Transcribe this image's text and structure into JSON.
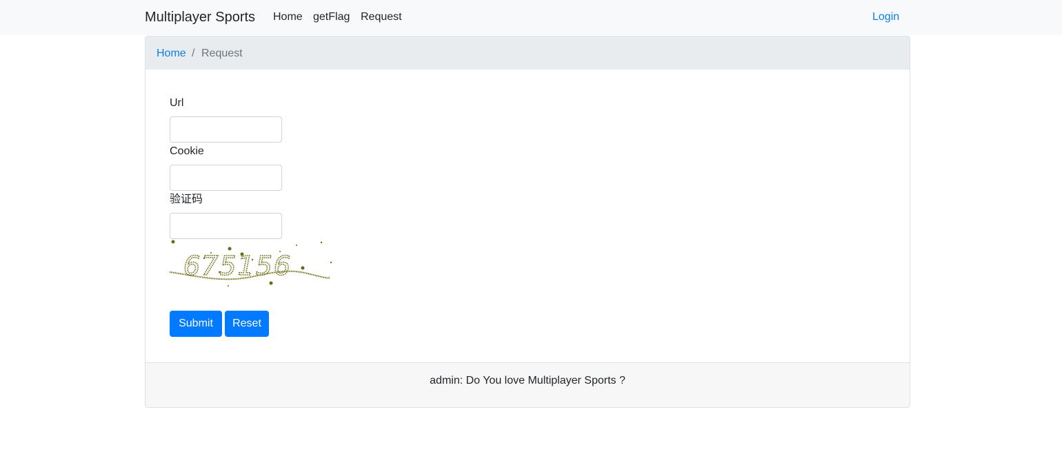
{
  "navbar": {
    "brand": "Multiplayer Sports",
    "links": [
      "Home",
      "getFlag",
      "Request"
    ],
    "login": "Login"
  },
  "breadcrumb": {
    "home": "Home",
    "separator": "/",
    "current": "Request"
  },
  "form": {
    "url_label": "Url",
    "url_value": "",
    "cookie_label": "Cookie",
    "cookie_value": "",
    "captcha_label": "验证码",
    "captcha_value": "",
    "captcha_image_text": "675156",
    "submit_label": "Submit",
    "reset_label": "Reset"
  },
  "footer": {
    "text": "admin: Do You love Multiplayer Sports ?"
  },
  "colors": {
    "link": "#0d7fe0",
    "primary_button": "#007bff",
    "navbar_bg": "#f8f9fa",
    "breadcrumb_bg": "#e9ecef",
    "captcha_ink": "#6b6b12"
  }
}
